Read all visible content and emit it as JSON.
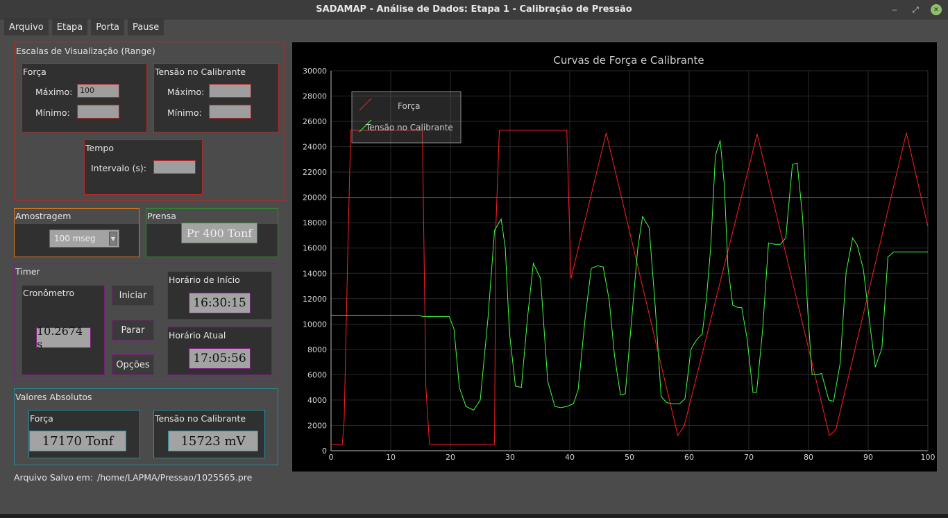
{
  "window": {
    "title": "SADAMAP - Análise de Dados: Etapa 1 - Calibração de Pressão",
    "min_glyph": "‒",
    "max_glyph": "⤢",
    "close_glyph": "✕"
  },
  "menu": [
    "Arquivo",
    "Etapa",
    "Porta",
    "Pause"
  ],
  "scales": {
    "title": "Escalas de Visualização (Range)",
    "forca": {
      "title": "Força",
      "max_label": "Máximo:",
      "max_value": "100",
      "min_label": "Mínimo:",
      "min_value": ""
    },
    "tensao": {
      "title": "Tensão no Calibrante",
      "max_label": "Máximo:",
      "max_value": "",
      "min_label": "Mínimo:",
      "min_value": ""
    },
    "tempo": {
      "title": "Tempo",
      "interval_label": "Intervalo (s):",
      "interval_value": ""
    }
  },
  "amostragem": {
    "title": "Amostragem",
    "selected": "100 mseg"
  },
  "prensa": {
    "title": "Prensa",
    "value": "Pr 400 Tonf"
  },
  "timer": {
    "title": "Timer",
    "cronometro_title": "Cronômetro",
    "cronometro_value": "10.2674 s",
    "btn_iniciar": "Iniciar",
    "btn_parar": "Parar",
    "btn_opcoes": "Opções",
    "inicio_title": "Horário de Início",
    "inicio_value": "16:30:15",
    "atual_title": "Horário Atual",
    "atual_value": "17:05:56"
  },
  "absolutos": {
    "title": "Valores Absolutos",
    "forca_title": "Força",
    "forca_value": "17170 Tonf",
    "tensao_title": "Tensão no Calibrante",
    "tensao_value": "15723 mV"
  },
  "footer": {
    "label": "Arquivo Salvo em:",
    "path": "/home/LAPMA/Pressao/1025565.pre"
  },
  "colors": {
    "forca": "#ff2020",
    "tensao": "#40ff40",
    "red_border": "#b12a2a",
    "orange_border": "#e07a20",
    "green_border": "#2e8b2e",
    "purple_border": "#7b1f7b",
    "cyan_border": "#2a8a9a"
  },
  "chart_data": {
    "type": "line",
    "title": "Curvas de Força e Calibrante",
    "xlim": [
      0,
      100
    ],
    "ylim": [
      0,
      30000
    ],
    "xticks": [
      0,
      10,
      20,
      30,
      40,
      50,
      60,
      70,
      80,
      90,
      100
    ],
    "yticks": [
      0,
      2000,
      4000,
      6000,
      8000,
      10000,
      12000,
      14000,
      16000,
      18000,
      20000,
      22000,
      24000,
      26000,
      28000,
      30000
    ],
    "grid": true,
    "legend_position": "top-left",
    "series": [
      {
        "name": "Força",
        "color": "#ff2020",
        "x": [
          0,
          1.9,
          2.2,
          2.9,
          3.3,
          15.3,
          15.9,
          16.5,
          27.4,
          27.6,
          28.2,
          39.5,
          40.2,
          46.1,
          58.1,
          59.2,
          71.4,
          83.5,
          84.6,
          96.4,
          100
        ],
        "y": [
          500,
          500,
          2400,
          17500,
          25300,
          25300,
          5000,
          500,
          500,
          17500,
          25300,
          25300,
          13600,
          25100,
          1200,
          2000,
          25000,
          1200,
          1700,
          25100,
          17700
        ]
      },
      {
        "name": "Tensão no Calibrante",
        "color": "#40ff40",
        "x": [
          0,
          14.8,
          15.3,
          19.8,
          20.6,
          21.5,
          22.6,
          23.9,
          25.0,
          26.3,
          27.4,
          28.5,
          29.2,
          29.9,
          30.9,
          31.9,
          32.9,
          33.9,
          35.1,
          36.3,
          37.5,
          38.5,
          39.5,
          40.6,
          41.4,
          42.6,
          43.6,
          44.7,
          45.6,
          46.6,
          47.5,
          48.5,
          49.3,
          50.3,
          51.4,
          52.2,
          53.3,
          54.3,
          55.3,
          56.2,
          57.3,
          58.4,
          59.3,
          60.3,
          60.9,
          61.5,
          62.2,
          62.9,
          63.6,
          64.4,
          65.2,
          65.9,
          66.5,
          67.3,
          68.2,
          68.8,
          69.7,
          70.7,
          71.3,
          72.3,
          73.3,
          74.3,
          75.3,
          76.2,
          77.3,
          78.1,
          79.0,
          79.9,
          80.6,
          81.4,
          82.2,
          83.4,
          84.2,
          85.3,
          86.3,
          87.4,
          88.2,
          89.2,
          90.3,
          91.2,
          92.3,
          93.3,
          94.3,
          95.3,
          96.3,
          97.3,
          98.3,
          99.4,
          100
        ],
        "y": [
          10700,
          10700,
          10600,
          10600,
          9600,
          5000,
          3500,
          3200,
          4000,
          10500,
          17400,
          18300,
          16000,
          9300,
          5100,
          5000,
          10400,
          14800,
          13600,
          5500,
          3500,
          3400,
          3500,
          3700,
          4800,
          10600,
          14400,
          14600,
          14500,
          11900,
          7500,
          4400,
          4500,
          10000,
          16000,
          18500,
          17600,
          11500,
          4300,
          3800,
          3700,
          3700,
          4100,
          8000,
          8500,
          8900,
          9200,
          12000,
          16000,
          23300,
          24500,
          21000,
          14500,
          11500,
          11300,
          11300,
          8900,
          4600,
          4600,
          9500,
          16400,
          16300,
          16300,
          16800,
          22600,
          22700,
          18500,
          10900,
          6000,
          6000,
          6100,
          4000,
          3900,
          6900,
          14100,
          16800,
          16200,
          14300,
          9900,
          6600,
          8100,
          15300,
          15700,
          15700,
          15700,
          15700,
          15700,
          15700,
          15700
        ]
      }
    ]
  }
}
